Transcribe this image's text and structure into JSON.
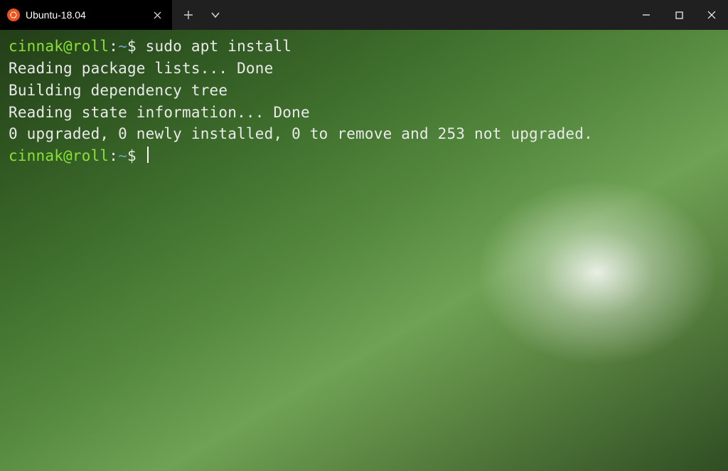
{
  "titlebar": {
    "tab_title": "Ubuntu-18.04"
  },
  "prompt": {
    "user_host": "cinnak@roll",
    "separator": ":",
    "path": "~",
    "sigil": "$ "
  },
  "session": {
    "command": "sudo apt install",
    "output_lines": [
      "Reading package lists... Done",
      "Building dependency tree",
      "Reading state information... Done",
      "0 upgraded, 0 newly installed, 0 to remove and 253 not upgraded."
    ]
  }
}
